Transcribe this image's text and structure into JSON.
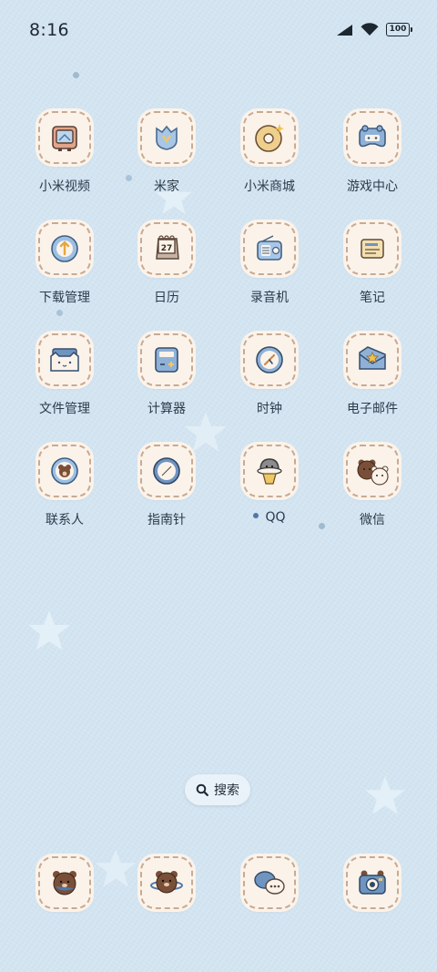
{
  "status_bar": {
    "time": "8:16",
    "battery": "100"
  },
  "apps": [
    {
      "label": "小米视频"
    },
    {
      "label": "米家"
    },
    {
      "label": "小米商城"
    },
    {
      "label": "游戏中心"
    },
    {
      "label": "下载管理"
    },
    {
      "label": "日历",
      "date": "27"
    },
    {
      "label": "录音机"
    },
    {
      "label": "笔记"
    },
    {
      "label": "文件管理"
    },
    {
      "label": "计算器"
    },
    {
      "label": "时钟"
    },
    {
      "label": "电子邮件"
    },
    {
      "label": "联系人"
    },
    {
      "label": "指南针"
    },
    {
      "label": "QQ",
      "has_notification_dot": true
    },
    {
      "label": "微信"
    }
  ],
  "search": {
    "label": "搜索"
  },
  "dock": [
    "bear-icon",
    "bear-planet-icon",
    "chat-bubbles-icon",
    "camera-icon"
  ],
  "colors": {
    "background": "#d3e4f1",
    "icon_tile": "#fbf3ea",
    "stitch": "#c9aa93",
    "accent_blue": "#4e78a8"
  }
}
